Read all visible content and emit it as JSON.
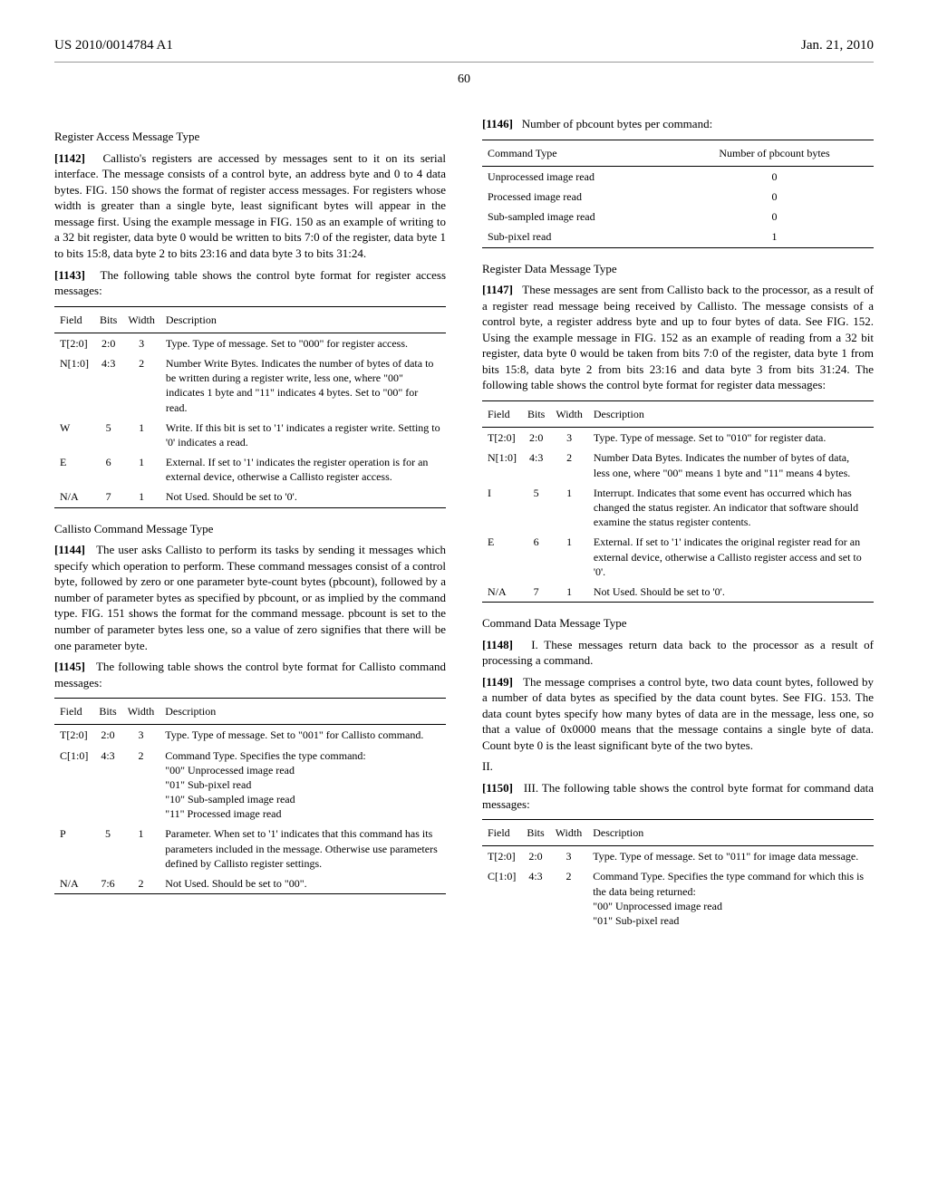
{
  "header": {
    "left": "US 2010/0014784 A1",
    "right": "Jan. 21, 2010"
  },
  "page_number_top": "60",
  "left_col": {
    "sec1_title": "Register Access Message Type",
    "p1142_num": "[1142]",
    "p1142": "Callisto's registers are accessed by messages sent to it on its serial interface. The message consists of a control byte, an address byte and 0 to 4 data bytes. FIG. 150 shows the format of register access messages. For registers whose width is greater than a single byte, least significant bytes will appear in the message first. Using the example message in FIG. 150 as an example of writing to a 32 bit register, data byte 0 would be written to bits 7:0 of the register, data byte 1 to bits 15:8, data byte 2 to bits 23:16 and data byte 3 to bits 31:24.",
    "p1143_num": "[1143]",
    "p1143": "The following table shows the control byte format for register access messages:",
    "table1": {
      "headers": [
        "Field",
        "Bits",
        "Width",
        "Description"
      ],
      "rows": [
        [
          "T[2:0]",
          "2:0",
          "3",
          "Type. Type of message. Set to \"000\" for register access."
        ],
        [
          "N[1:0]",
          "4:3",
          "2",
          "Number Write Bytes. Indicates the number of bytes of data to be written during a register write, less one, where \"00\" indicates 1 byte and \"11\" indicates 4 bytes. Set to \"00\" for read."
        ],
        [
          "W",
          "5",
          "1",
          "Write. If this bit is set to '1' indicates a register write. Setting to '0' indicates a read."
        ],
        [
          "E",
          "6",
          "1",
          "External. If set to '1' indicates the register operation is for an external device, otherwise a Callisto register access."
        ],
        [
          "N/A",
          "7",
          "1",
          "Not Used. Should be set to '0'."
        ]
      ]
    },
    "sec2_title": "Callisto Command Message Type",
    "p1144_num": "[1144]",
    "p1144": "The user asks Callisto to perform its tasks by sending it messages which specify which operation to perform. These command messages consist of a control byte, followed by zero or one parameter byte-count bytes (pbcount), followed by a number of parameter bytes as specified by pbcount, or as implied by the command type. FIG. 151 shows the format for the command message. pbcount is set to the number of parameter bytes less one, so a value of zero signifies that there will be one parameter byte.",
    "p1145_num": "[1145]",
    "p1145": "The following table shows the control byte format for Callisto command messages:",
    "table2": {
      "headers": [
        "Field",
        "Bits",
        "Width",
        "Description"
      ],
      "rows": [
        [
          "T[2:0]",
          "2:0",
          "3",
          "Type. Type of message. Set to \"001\" for Callisto command."
        ],
        [
          "C[1:0]",
          "4:3",
          "2",
          "Command Type. Specifies the type command:\n\"00\" Unprocessed image read\n\"01\" Sub-pixel read\n\"10\" Sub-sampled image read\n\"11\" Processed image read"
        ],
        [
          "P",
          "5",
          "1",
          "Parameter. When set to '1' indicates that this command has its parameters included in the message. Otherwise use parameters defined by Callisto register settings."
        ],
        [
          "N/A",
          "7:6",
          "2",
          "Not Used. Should be set to \"00\"."
        ]
      ]
    }
  },
  "right_col": {
    "p1146_num": "[1146]",
    "p1146": "Number of pbcount bytes per command:",
    "table3": {
      "headers": [
        "Command Type",
        "Number of pbcount bytes"
      ],
      "rows": [
        [
          "Unprocessed image read",
          "0"
        ],
        [
          "Processed image read",
          "0"
        ],
        [
          "Sub-sampled image read",
          "0"
        ],
        [
          "Sub-pixel read",
          "1"
        ]
      ]
    },
    "sec3_title": "Register Data Message Type",
    "p1147_num": "[1147]",
    "p1147": "These messages are sent from Callisto back to the processor, as a result of a register read message being received by Callisto. The message consists of a control byte, a register address byte and up to four bytes of data. See FIG. 152. Using the example message in FIG. 152 as an example of reading from a 32 bit register, data byte 0 would be taken from bits 7:0 of the register, data byte 1 from bits 15:8, data byte 2 from bits 23:16 and data byte 3 from bits 31:24. The following table shows the control byte format for register data messages:",
    "table4": {
      "headers": [
        "Field",
        "Bits",
        "Width",
        "Description"
      ],
      "rows": [
        [
          "T[2:0]",
          "2:0",
          "3",
          "Type. Type of message. Set to \"010\" for register data."
        ],
        [
          "N[1:0]",
          "4:3",
          "2",
          "Number Data Bytes. Indicates the number of bytes of data, less one, where \"00\" means 1 byte and \"11\" means 4 bytes."
        ],
        [
          "I",
          "5",
          "1",
          "Interrupt. Indicates that some event has occurred which has changed the status register. An indicator that software should examine the status register contents."
        ],
        [
          "E",
          "6",
          "1",
          "External. If set to '1' indicates the original register read for an external device, otherwise a Callisto register access and set to '0'."
        ],
        [
          "N/A",
          "7",
          "1",
          "Not Used. Should be set to '0'."
        ]
      ]
    },
    "sec4_title": "Command Data Message Type",
    "p1148_num": "[1148]",
    "p1148": "I. These messages return data back to the processor as a result of processing a command.",
    "p1149_num": "[1149]",
    "p1149": "The message comprises a control byte, two data count bytes, followed by a number of data bytes as specified by the data count bytes. See FIG. 153. The data count bytes specify how many bytes of data are in the message, less one, so that a value of 0x0000 means that the message contains a single byte of data. Count byte 0 is the least significant byte of the two bytes.",
    "p_ii": "II.",
    "p1150_num": "[1150]",
    "p1150": "III. The following table shows the control byte format for command data messages:",
    "table5": {
      "headers": [
        "Field",
        "Bits",
        "Width",
        "Description"
      ],
      "rows": [
        [
          "T[2:0]",
          "2:0",
          "3",
          "Type. Type of message. Set to \"011\" for image data message."
        ],
        [
          "C[1:0]",
          "4:3",
          "2",
          "Command Type. Specifies the type command for which this is the data being returned:\n\"00\" Unprocessed image read\n\"01\" Sub-pixel read"
        ]
      ]
    }
  }
}
